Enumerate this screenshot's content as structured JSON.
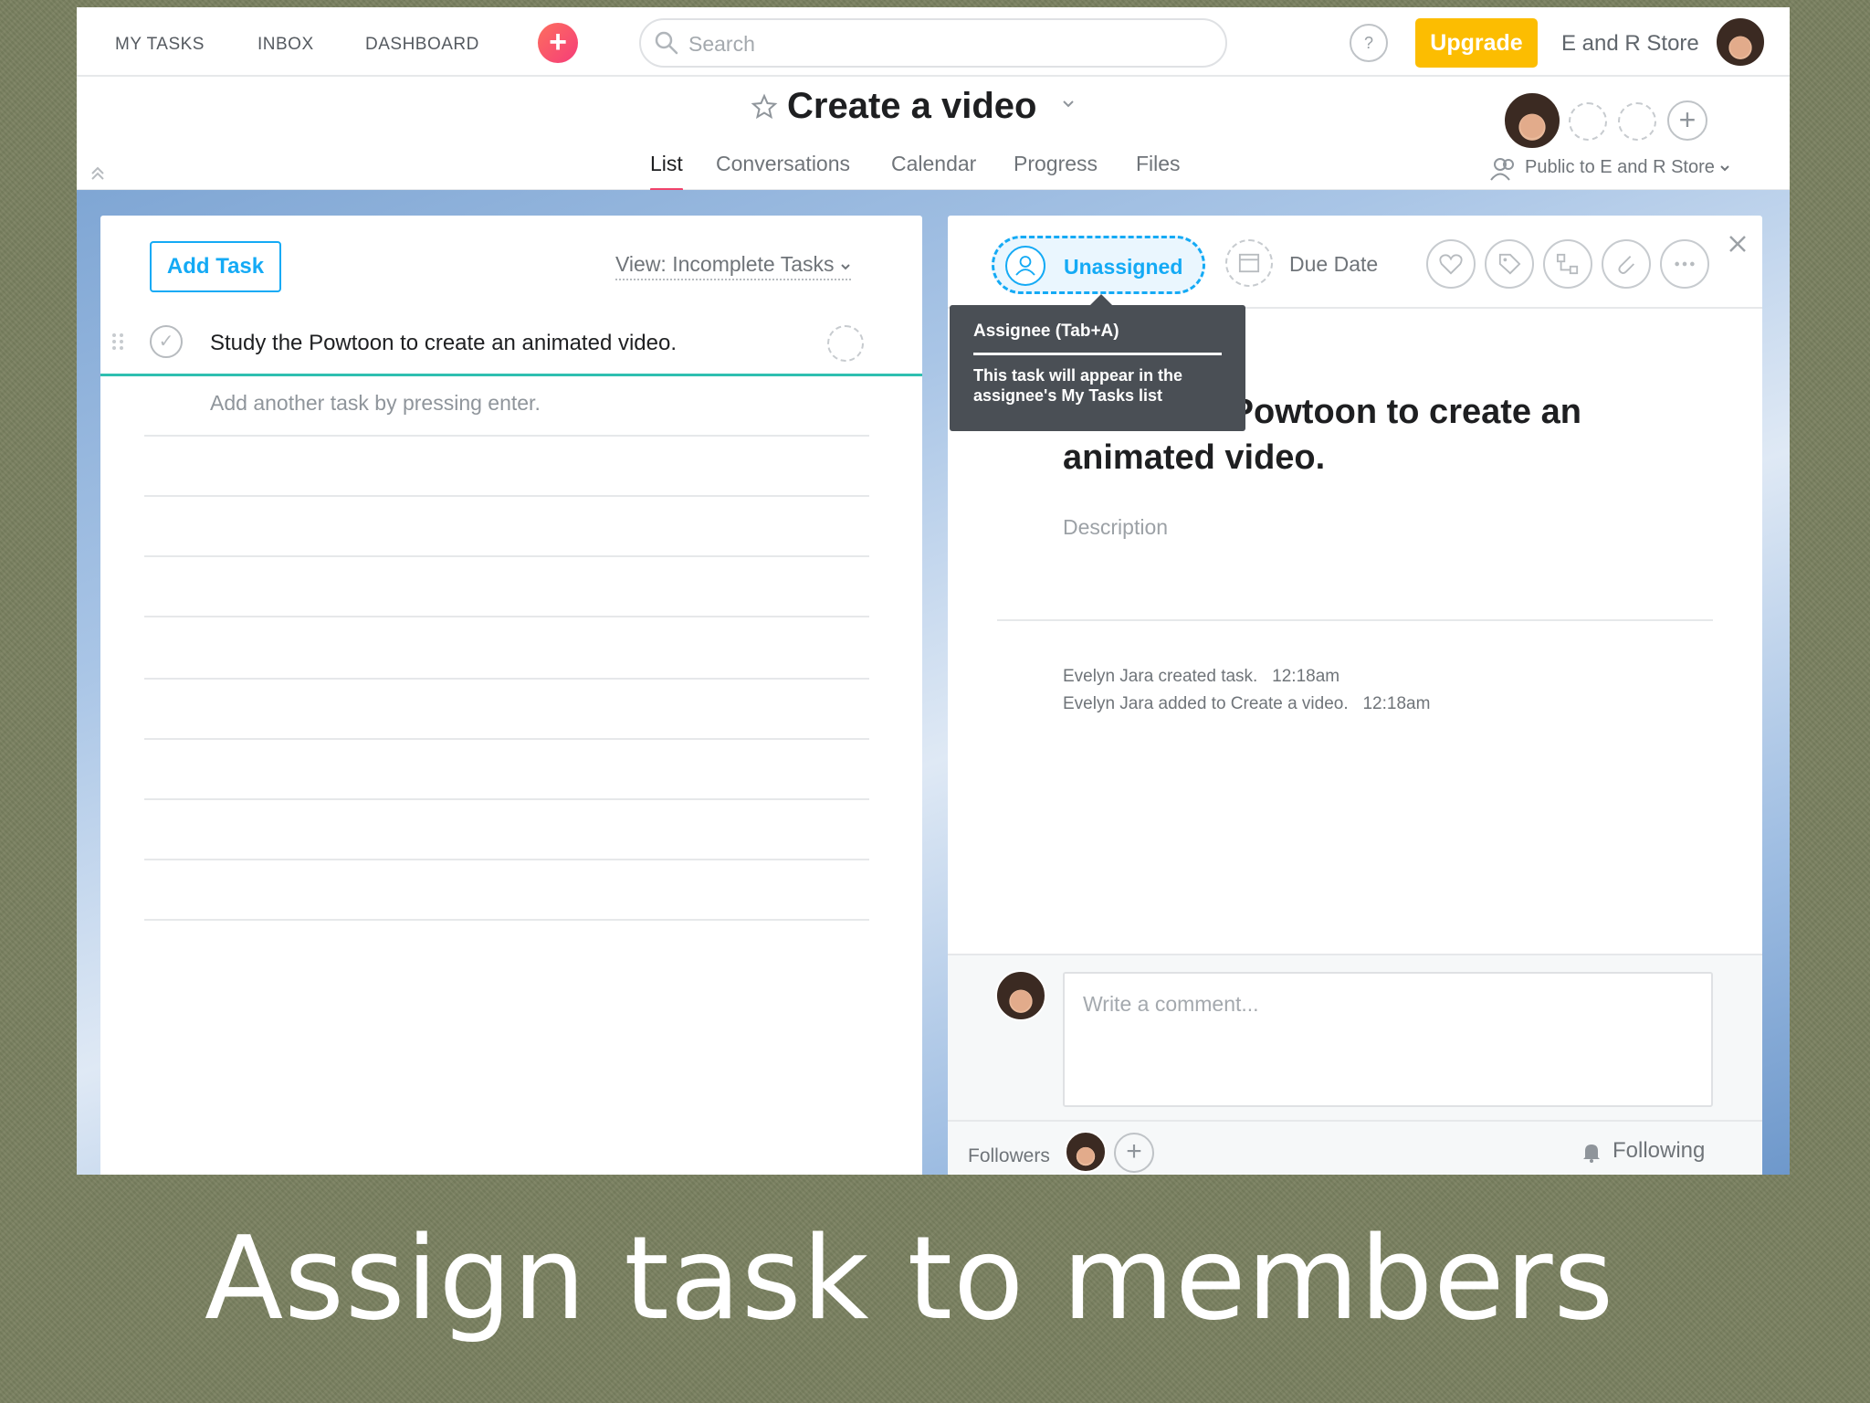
{
  "nav": {
    "links": [
      "MY TASKS",
      "INBOX",
      "DASHBOARD"
    ],
    "quick_add": "+",
    "search_placeholder": "Search",
    "help": "?",
    "upgrade": "Upgrade",
    "org_name": "E and R Store"
  },
  "project": {
    "title": "Create a video",
    "tabs": [
      "List",
      "Conversations",
      "Calendar",
      "Progress",
      "Files"
    ],
    "active_tab": "List",
    "privacy": "Public to E and R Store",
    "member_add": "+"
  },
  "task_list": {
    "add_task": "Add Task",
    "view_filter": "View: Incomplete Tasks",
    "tasks": [
      {
        "name": "Study the Powtoon to create an animated video.",
        "completed": false
      }
    ],
    "hint": "Add another task by pressing enter.",
    "empty_rows": 9
  },
  "task_detail": {
    "assignee": "Unassigned",
    "due_date": "Due Date",
    "tooltip": {
      "title": "Assignee (Tab+A)",
      "body": "This task will appear in the assignee's My Tasks list"
    },
    "task_name": "Study the Powtoon to create an animated video.",
    "description_placeholder": "Description",
    "stories": [
      {
        "text": "Evelyn Jara created task.",
        "time": "12:18am"
      },
      {
        "text": "Evelyn Jara added to Create a video.",
        "time": "12:18am"
      }
    ],
    "comment_placeholder": "Write a comment...",
    "followers_label": "Followers",
    "follower_add": "+",
    "following": "Following"
  },
  "colors": {
    "accent": "#14aaf5",
    "upgrade": "#fcbd01",
    "tab_underline": "#f0426a",
    "slide_background": "#7a8160"
  },
  "caption": "Assign task to members"
}
